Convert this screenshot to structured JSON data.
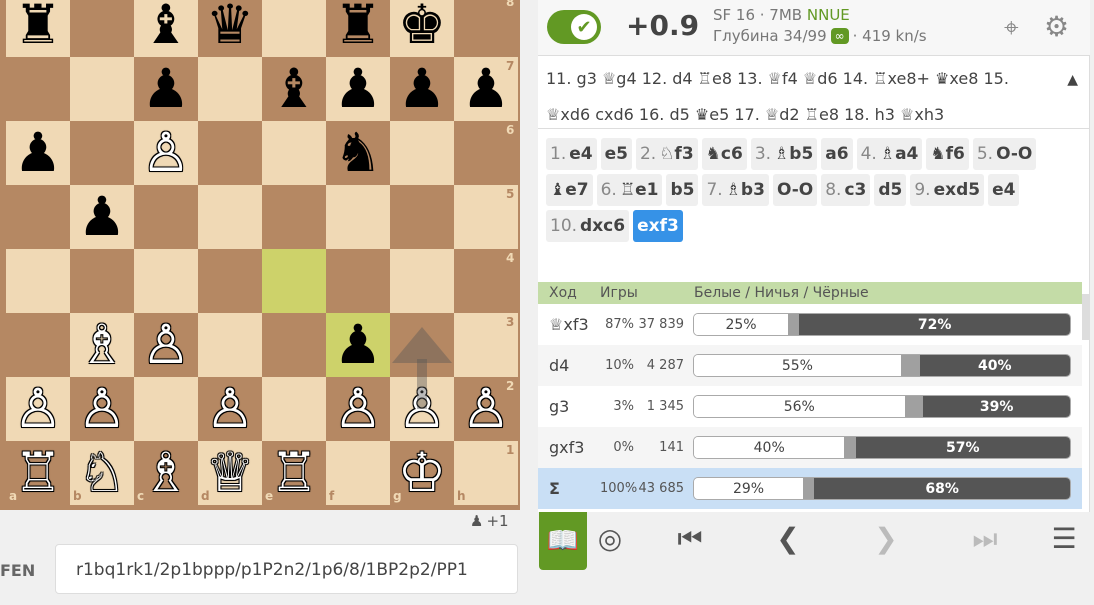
{
  "board": {
    "files": [
      "a",
      "b",
      "c",
      "d",
      "e",
      "f",
      "g",
      "h"
    ],
    "ranks": [
      "8",
      "7",
      "6",
      "5",
      "4",
      "3",
      "2",
      "1"
    ],
    "highlight_squares": [
      "e4",
      "f3"
    ],
    "arrow": {
      "from": "g2",
      "to": "g3",
      "color": "#555555"
    },
    "pieces": [
      {
        "sq": "a8",
        "glyph": "♜",
        "color": "b"
      },
      {
        "sq": "c8",
        "glyph": "♝",
        "color": "b"
      },
      {
        "sq": "d8",
        "glyph": "♛",
        "color": "b"
      },
      {
        "sq": "f8",
        "glyph": "♜",
        "color": "b"
      },
      {
        "sq": "g8",
        "glyph": "♚",
        "color": "b"
      },
      {
        "sq": "c7",
        "glyph": "♟",
        "color": "b"
      },
      {
        "sq": "e7",
        "glyph": "♝",
        "color": "b"
      },
      {
        "sq": "f7",
        "glyph": "♟",
        "color": "b"
      },
      {
        "sq": "g7",
        "glyph": "♟",
        "color": "b"
      },
      {
        "sq": "h7",
        "glyph": "♟",
        "color": "b"
      },
      {
        "sq": "a6",
        "glyph": "♟",
        "color": "b"
      },
      {
        "sq": "c6",
        "glyph": "♙",
        "color": "w"
      },
      {
        "sq": "f6",
        "glyph": "♞",
        "color": "b"
      },
      {
        "sq": "b5",
        "glyph": "♟",
        "color": "b"
      },
      {
        "sq": "b3",
        "glyph": "♗",
        "color": "w"
      },
      {
        "sq": "c3",
        "glyph": "♙",
        "color": "w"
      },
      {
        "sq": "f3",
        "glyph": "♟",
        "color": "b"
      },
      {
        "sq": "a2",
        "glyph": "♙",
        "color": "w"
      },
      {
        "sq": "b2",
        "glyph": "♙",
        "color": "w"
      },
      {
        "sq": "d2",
        "glyph": "♙",
        "color": "w"
      },
      {
        "sq": "f2",
        "glyph": "♙",
        "color": "w"
      },
      {
        "sq": "g2",
        "glyph": "♙",
        "color": "w"
      },
      {
        "sq": "h2",
        "glyph": "♙",
        "color": "w"
      },
      {
        "sq": "a1",
        "glyph": "♖",
        "color": "w"
      },
      {
        "sq": "b1",
        "glyph": "♘",
        "color": "w"
      },
      {
        "sq": "c1",
        "glyph": "♗",
        "color": "w"
      },
      {
        "sq": "d1",
        "glyph": "♕",
        "color": "w"
      },
      {
        "sq": "e1",
        "glyph": "♖",
        "color": "w"
      },
      {
        "sq": "g1",
        "glyph": "♔",
        "color": "w"
      }
    ]
  },
  "under_board": {
    "icon": "pawn-icon",
    "text": "+1"
  },
  "fen": {
    "label": "FEN",
    "value": "r1bq1rk1/2p1bppp/p1P2n2/1p6/8/1BP2p2/PP1"
  },
  "ceval": {
    "eval": "+0.9",
    "engine": "SF 16 · 7MB",
    "nnue": "NNUE",
    "depth": "Глубина 34/99",
    "inf": "∞",
    "speed": "· 419 kn/s"
  },
  "pv": {
    "text": "11. g3 ♕g4 12. d4 ♖e8 13. ♕f4 ♕d6 14. ♖xe8+ ♛xe8 15. ♕xd6 cxd6 16. d5 ♛e5 17. ♕d2 ♖e8 18. h3 ♕xh3",
    "toggle": "▲"
  },
  "moves": [
    {
      "num": "1.",
      "san": "e4"
    },
    {
      "num": "",
      "san": "e5"
    },
    {
      "num": "2.",
      "san": "♘f3"
    },
    {
      "num": "",
      "san": "♞c6"
    },
    {
      "num": "3.",
      "san": "♗b5"
    },
    {
      "num": "",
      "san": "a6"
    },
    {
      "num": "4.",
      "san": "♗a4"
    },
    {
      "num": "",
      "san": "♞f6"
    },
    {
      "num": "5.",
      "san": "O-O"
    },
    {
      "num": "",
      "san": "♝e7"
    },
    {
      "num": "6.",
      "san": "♖e1"
    },
    {
      "num": "",
      "san": "b5"
    },
    {
      "num": "7.",
      "san": "♗b3"
    },
    {
      "num": "",
      "san": "O-O"
    },
    {
      "num": "8.",
      "san": "c3"
    },
    {
      "num": "",
      "san": "d5"
    },
    {
      "num": "9.",
      "san": "exd5"
    },
    {
      "num": "",
      "san": "e4"
    },
    {
      "num": "10.",
      "san": "dxc6"
    },
    {
      "num": "",
      "san": "exf3",
      "active": true
    }
  ],
  "explorer": {
    "headers": {
      "move": "Ход",
      "games": "Игры",
      "result": "Белые / Ничья / Чёрные"
    },
    "rows": [
      {
        "move": "♕xf3",
        "pct": "87%",
        "games": "37 839",
        "white": 25,
        "draw": 3,
        "black": 72,
        "white_label": "25%",
        "black_label": "72%"
      },
      {
        "move": "d4",
        "pct": "10%",
        "games": "4 287",
        "white": 55,
        "draw": 5,
        "black": 40,
        "white_label": "55%",
        "black_label": "40%"
      },
      {
        "move": "g3",
        "pct": "3%",
        "games": "1 345",
        "white": 56,
        "draw": 5,
        "black": 39,
        "white_label": "56%",
        "black_label": "39%"
      },
      {
        "move": "gxf3",
        "pct": "0%",
        "games": "141",
        "white": 40,
        "draw": 3,
        "black": 57,
        "white_label": "40%",
        "black_label": "57%"
      },
      {
        "move": "Σ",
        "pct": "100%",
        "games": "43 685",
        "white": 29,
        "draw": 3,
        "black": 68,
        "white_label": "29%",
        "black_label": "68%",
        "total": true
      }
    ]
  },
  "controls": {
    "book": "book-icon",
    "practice": "◎",
    "first": "⏮",
    "prev": "❮",
    "next": "❯",
    "last": "⏭",
    "menu": "☰"
  },
  "colors": {
    "accent": "#629924",
    "active_move": "#3692e7",
    "highlight": "#cdd26a"
  }
}
